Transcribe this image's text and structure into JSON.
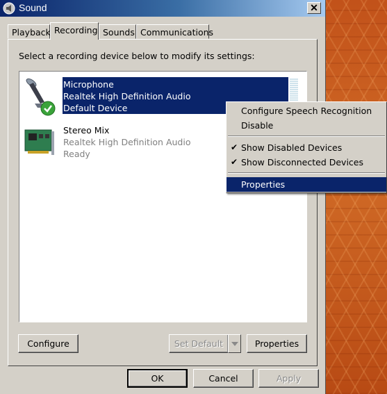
{
  "window": {
    "title": "Sound"
  },
  "tabs": [
    {
      "label": "Playback"
    },
    {
      "label": "Recording"
    },
    {
      "label": "Sounds"
    },
    {
      "label": "Communications"
    }
  ],
  "instruction": "Select a recording device below to modify its settings:",
  "devices": [
    {
      "name": "Microphone",
      "driver": "Realtek High Definition Audio",
      "status": "Default Device"
    },
    {
      "name": "Stereo Mix",
      "driver": "Realtek High Definition Audio",
      "status": "Ready"
    }
  ],
  "buttons": {
    "configure": "Configure",
    "set_default": "Set Default",
    "properties": "Properties",
    "ok": "OK",
    "cancel": "Cancel",
    "apply": "Apply"
  },
  "context_menu": [
    {
      "label": "Configure Speech Recognition",
      "checked": false
    },
    {
      "label": "Disable",
      "checked": false
    },
    {
      "label": "Show Disabled Devices",
      "checked": true
    },
    {
      "label": "Show Disconnected Devices",
      "checked": true
    },
    {
      "label": "Properties",
      "checked": false,
      "highlighted": true
    }
  ],
  "colors": {
    "selection": "#0a246a",
    "dialog": "#d4d0c8",
    "check_badge": "#3aa33a"
  }
}
